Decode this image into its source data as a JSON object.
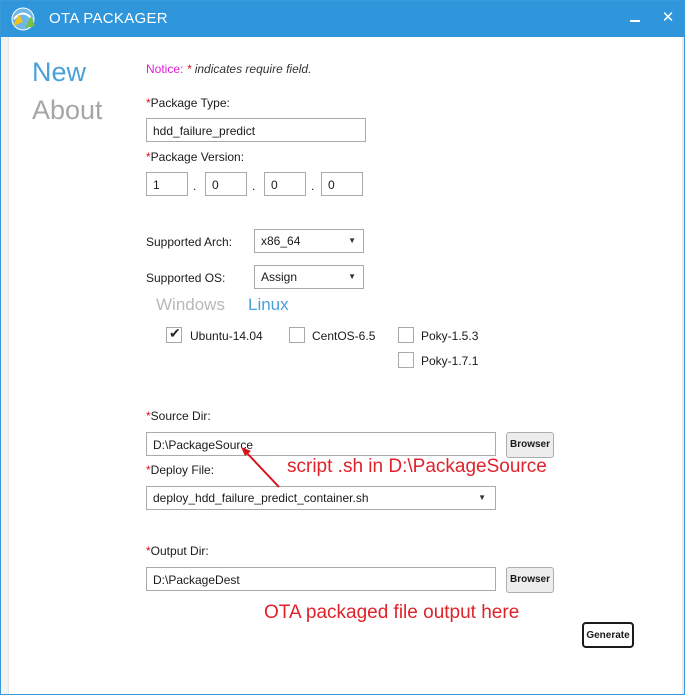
{
  "window": {
    "title": "OTA PACKAGER"
  },
  "titlebar": {
    "minimize_icon": "minimize-icon",
    "close_glyph": "✕"
  },
  "nav": {
    "new_label": "New",
    "about_label": "About"
  },
  "notice": {
    "label": "Notice:",
    "star": "*",
    "text": " indicates require field."
  },
  "package_type": {
    "star": "*",
    "label": "Package Type:",
    "value": "hdd_failure_predict"
  },
  "package_version": {
    "star": "*",
    "label": "Package Version:",
    "parts": [
      "1",
      "0",
      "0",
      "0"
    ],
    "separator": "."
  },
  "arch": {
    "label": "Supported Arch:",
    "value": "x86_64"
  },
  "os": {
    "label": "Supported OS:",
    "value": "Assign"
  },
  "os_tabs": {
    "windows": "Windows",
    "linux": "Linux"
  },
  "os_options": [
    {
      "label": "Ubuntu-14.04",
      "checked": true
    },
    {
      "label": "CentOS-6.5",
      "checked": false
    },
    {
      "label": "Poky-1.5.3",
      "checked": false
    },
    {
      "label": "Poky-1.7.1",
      "checked": false
    }
  ],
  "source_dir": {
    "star": "*",
    "label": "Source Dir:",
    "value": "D:\\PackageSource",
    "browse_label": "Browser"
  },
  "deploy_file": {
    "star": "*",
    "label": "Deploy File:",
    "value": "deploy_hdd_failure_predict_container.sh"
  },
  "output_dir": {
    "star": "*",
    "label": "Output Dir:",
    "value": "D:\\PackageDest",
    "browse_label": "Browser"
  },
  "generate": {
    "label": "Generate"
  },
  "annotations": {
    "script_note": "script .sh in D:\\PackageSource",
    "output_note": "OTA packaged file output here"
  },
  "colors": {
    "titlebar": "#2f96db",
    "accent": "#4ba1d6",
    "required": "#d4131b",
    "annotation": "#e0222a"
  }
}
